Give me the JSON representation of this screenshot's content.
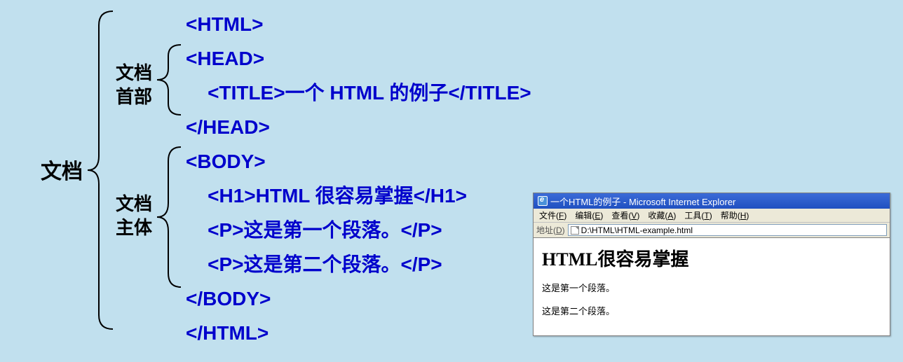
{
  "labels": {
    "document": "文档",
    "head_l1": "文档",
    "head_l2": "首部",
    "body_l1": "文档",
    "body_l2": "主体"
  },
  "code": {
    "l1": "<HTML>",
    "l2": "<HEAD>",
    "l3": "    <TITLE>一个 HTML 的例子</TITLE>",
    "l4": "</HEAD>",
    "l5": "<BODY>",
    "l6": "    <H1>HTML 很容易掌握</H1>",
    "l7": "    <P>这是第一个段落。</P>",
    "l8": "    <P>这是第二个段落。</P>",
    "l9": "</BODY>",
    "l10": "</HTML>"
  },
  "ie": {
    "title": "一个HTML的例子 - Microsoft Internet Explorer",
    "menu": {
      "file": "文件(F)",
      "edit": "编辑(E)",
      "view": "查看(V)",
      "favorites": "收藏(A)",
      "tools": "工具(T)",
      "help": "帮助(H)"
    },
    "addr_label": "地址(D)",
    "addr_value": "D:\\HTML\\HTML-example.html",
    "page": {
      "h1": "HTML很容易掌握",
      "p1": "这是第一个段落。",
      "p2": "这是第二个段落。"
    }
  }
}
